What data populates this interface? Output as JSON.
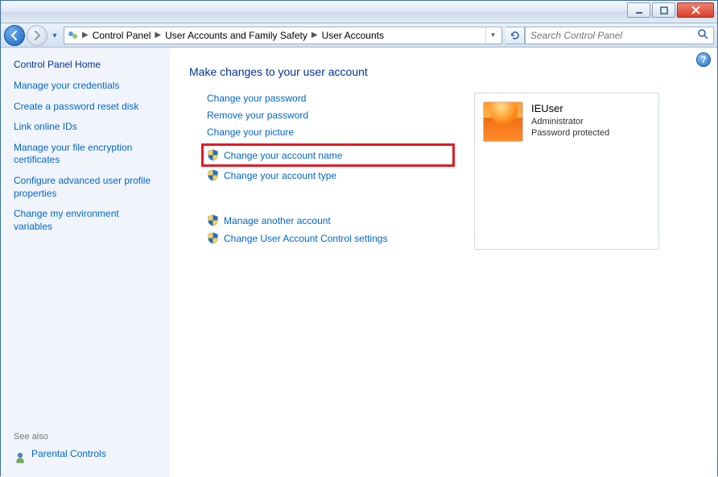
{
  "breadcrumb": {
    "items": [
      "Control Panel",
      "User Accounts and Family Safety",
      "User Accounts"
    ]
  },
  "search": {
    "placeholder": "Search Control Panel"
  },
  "sidebar": {
    "home": "Control Panel Home",
    "links": [
      "Manage your credentials",
      "Create a password reset disk",
      "Link online IDs",
      "Manage your file encryption certificates",
      "Configure advanced user profile properties",
      "Change my environment variables"
    ],
    "see_also_label": "See also",
    "parental_controls": "Parental Controls"
  },
  "main": {
    "heading": "Make changes to your user account",
    "actions": [
      {
        "label": "Change your password",
        "shield": false,
        "highlight": false
      },
      {
        "label": "Remove your password",
        "shield": false,
        "highlight": false
      },
      {
        "label": "Change your picture",
        "shield": false,
        "highlight": false
      },
      {
        "label": "Change your account name",
        "shield": true,
        "highlight": true
      },
      {
        "label": "Change your account type",
        "shield": true,
        "highlight": false
      }
    ],
    "actions_secondary": [
      {
        "label": "Manage another account",
        "shield": true
      },
      {
        "label": "Change User Account Control settings",
        "shield": true
      }
    ],
    "user": {
      "name": "IEUser",
      "role": "Administrator",
      "protection": "Password protected"
    }
  }
}
